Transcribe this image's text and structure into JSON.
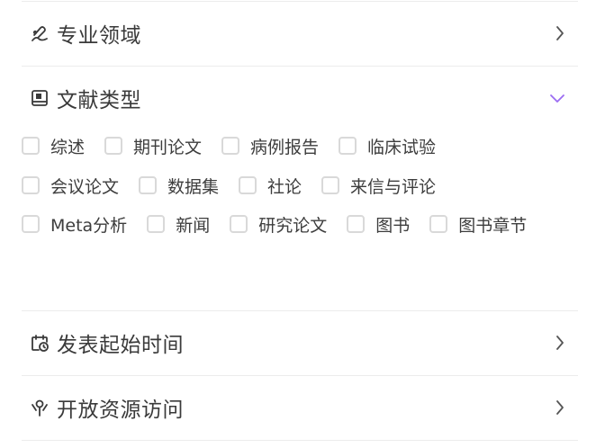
{
  "sections": {
    "expertise": {
      "title": "专业领域",
      "icon": "writing-hand-icon",
      "expanded": false
    },
    "doc_type": {
      "title": "文献类型",
      "icon": "book-icon",
      "expanded": true
    },
    "pub_date": {
      "title": "发表起始时间",
      "icon": "calendar-clock-icon",
      "expanded": false
    },
    "open_access": {
      "title": "开放资源访问",
      "icon": "open-access-icon",
      "expanded": false
    }
  },
  "doc_type_options": [
    [
      "综述",
      "期刊论文",
      "病例报告",
      "临床试验"
    ],
    [
      "会议论文",
      "数据集",
      "社论",
      "来信与评论"
    ],
    [
      "Meta分析",
      "新闻",
      "研究论文",
      "图书",
      "图书章节"
    ]
  ],
  "colors": {
    "accent": "#9b6cf2",
    "divider": "#ececec",
    "checkbox_border": "#d9d9d9"
  }
}
